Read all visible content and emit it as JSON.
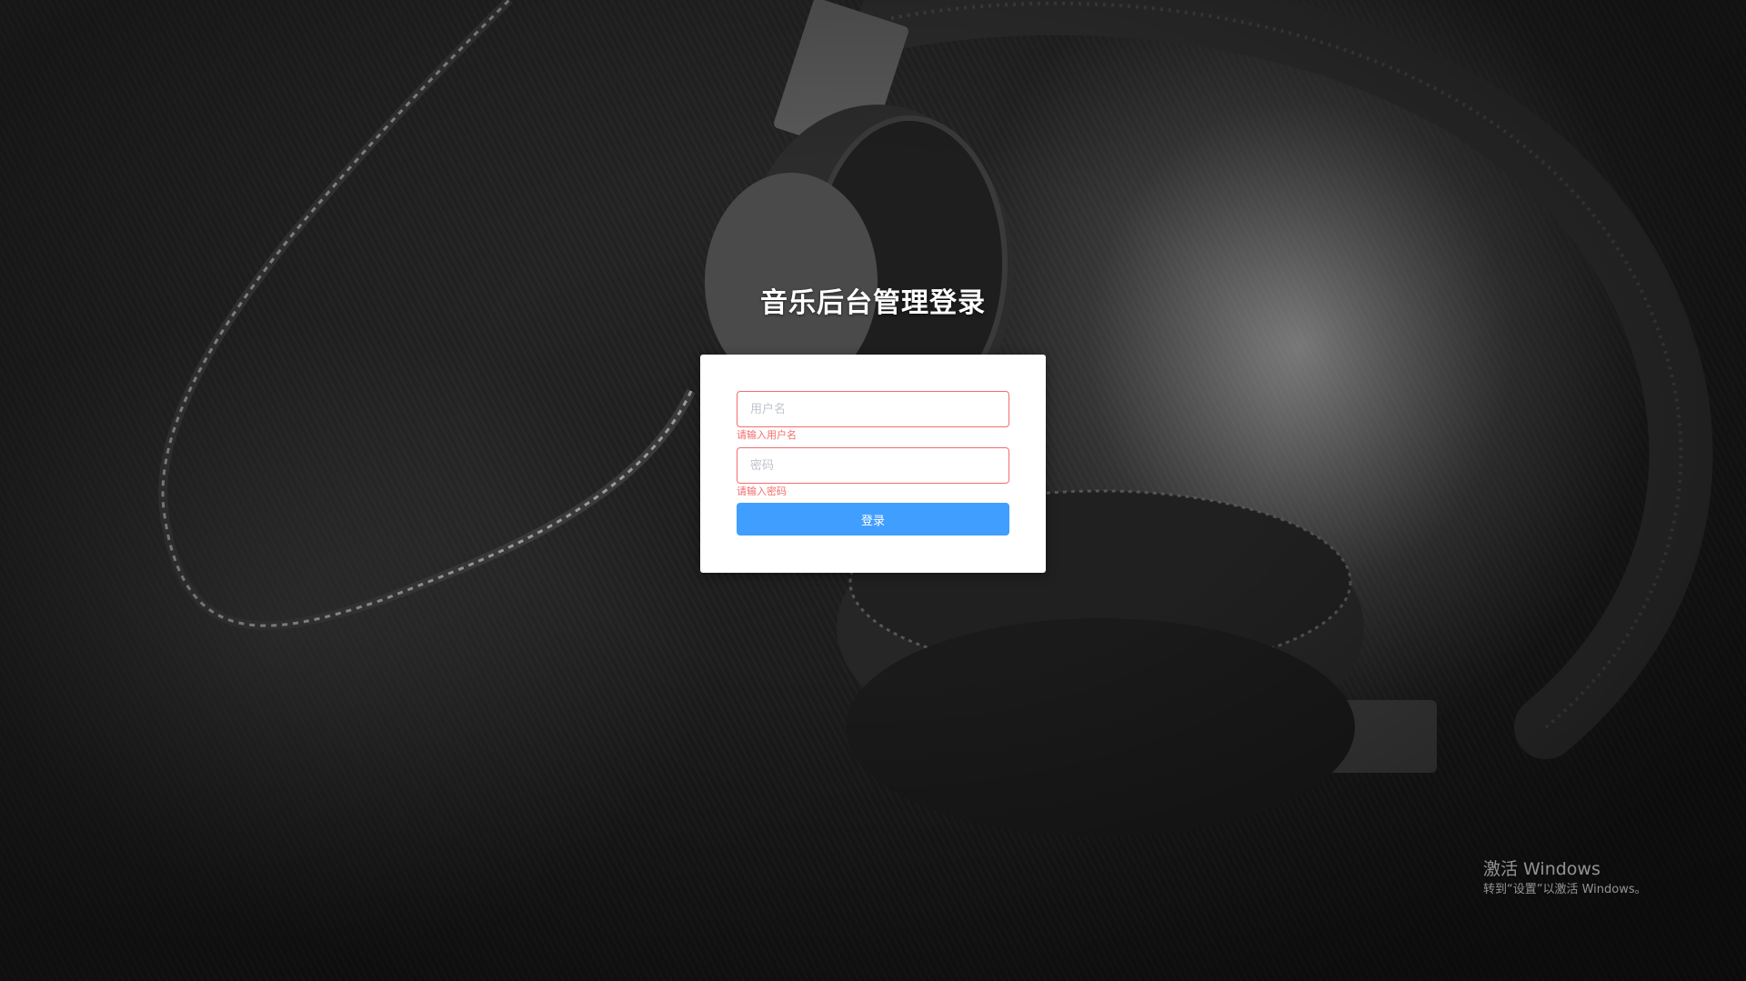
{
  "login": {
    "title": "音乐后台管理登录",
    "username": {
      "placeholder": "用户名",
      "value": "",
      "error": "请输入用户名"
    },
    "password": {
      "placeholder": "密码",
      "value": "",
      "error": "请输入密码"
    },
    "submit_label": "登录"
  },
  "watermark": {
    "title": "激活 Windows",
    "subtitle": "转到“设置”以激活 Windows。"
  },
  "colors": {
    "primary": "#409eff",
    "error": "#f56c6c",
    "card_bg": "#ffffff"
  }
}
